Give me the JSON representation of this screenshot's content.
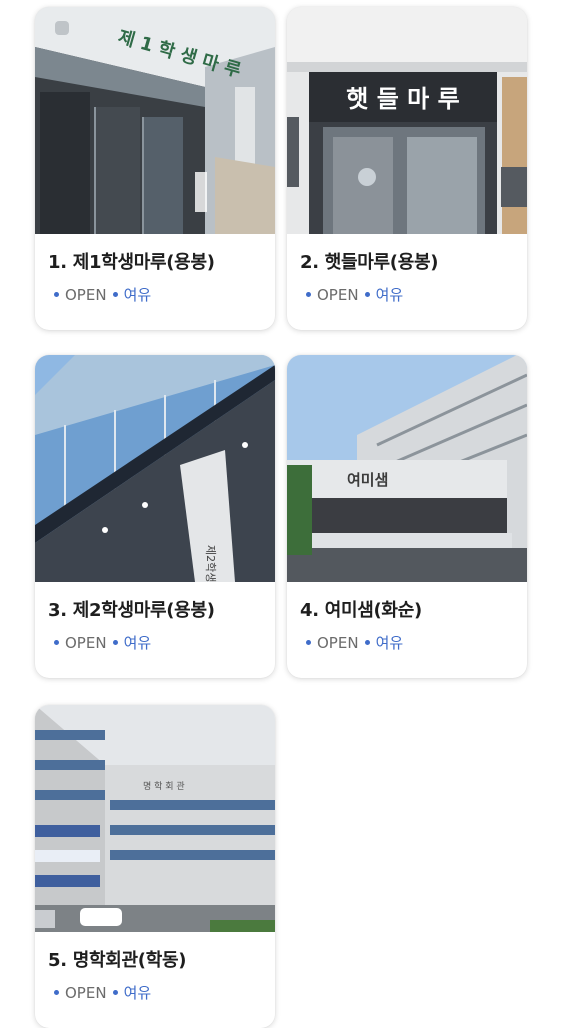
{
  "cafeterias": [
    {
      "title": "1. 제1학생마루(용봉)",
      "status": "OPEN",
      "availability": "여유",
      "sign": "제 1 학 생 마 루"
    },
    {
      "title": "2. 햇들마루(용봉)",
      "status": "OPEN",
      "availability": "여유",
      "sign": "햇 들 마 루"
    },
    {
      "title": "3. 제2학생마루(용봉)",
      "status": "OPEN",
      "availability": "여유",
      "sign": "제2학생"
    },
    {
      "title": "4. 여미샘(화순)",
      "status": "OPEN",
      "availability": "여유",
      "sign": "여미샘"
    },
    {
      "title": "5. 명학회관(학동)",
      "status": "OPEN",
      "availability": "여유",
      "sign": "명 학 회 관"
    }
  ],
  "colors": {
    "accent": "#3f6cc9",
    "title": "#1e1e1e",
    "status": "#6b6b6b"
  }
}
